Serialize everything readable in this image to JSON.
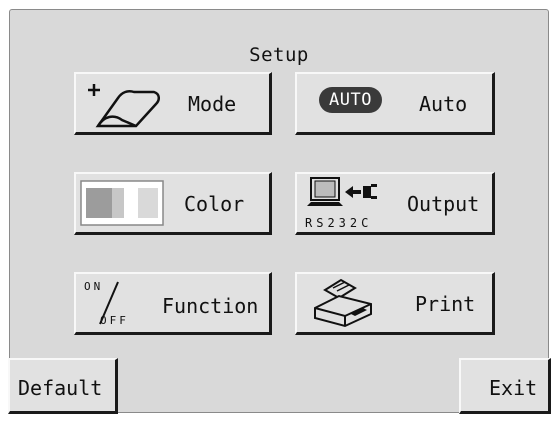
{
  "title": "Setup",
  "buttons": {
    "mode": "Mode",
    "auto_badge": "AUTO",
    "auto": "Auto",
    "color": "Color",
    "output": "Output",
    "output_port": "RS232C",
    "function": "Function",
    "on": "ON",
    "off": "OFF",
    "print": "Print",
    "default": "Default",
    "exit": "Exit"
  },
  "icons": {
    "mode": "pen-stroke-plus-icon",
    "color": "color-swatch-icon",
    "output": "computer-output-icon",
    "function": "on-off-switch-icon",
    "print": "printer-icon"
  },
  "colors": {
    "panel": "#d9d9d9",
    "button_face": "#e1e1e1",
    "badge": "#3a3a3a"
  }
}
